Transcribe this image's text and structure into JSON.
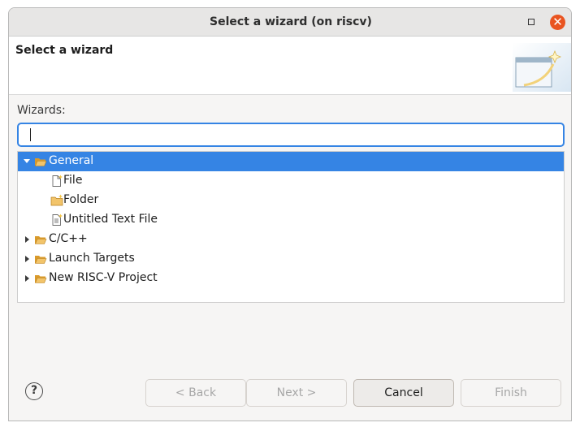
{
  "window": {
    "title": "Select a wizard  (on riscv)",
    "controls": {
      "maximize_icon": "maximize-icon",
      "close_icon": "close-icon",
      "close_glyph": "✕"
    }
  },
  "header": {
    "title": "Select a wizard",
    "graphic_icon": "wizard-banner-icon"
  },
  "filter": {
    "label": "Wizards:",
    "value": "",
    "placeholder": ""
  },
  "tree": {
    "items": [
      {
        "label": "General",
        "level": 0,
        "expanded": true,
        "selected": true,
        "icon": "folder-open-icon"
      },
      {
        "label": "File",
        "level": 1,
        "icon": "new-file-icon"
      },
      {
        "label": "Folder",
        "level": 1,
        "icon": "new-folder-icon"
      },
      {
        "label": "Untitled Text File",
        "level": 1,
        "icon": "new-text-file-icon"
      },
      {
        "label": "C/C++",
        "level": 0,
        "expanded": false,
        "icon": "folder-icon"
      },
      {
        "label": "Launch Targets",
        "level": 0,
        "expanded": false,
        "icon": "folder-icon"
      },
      {
        "label": "New RISC-V Project",
        "level": 0,
        "expanded": false,
        "icon": "folder-icon"
      }
    ]
  },
  "footer": {
    "help_glyph": "?",
    "back_label": "< Back",
    "next_label": "Next >",
    "cancel_label": "Cancel",
    "finish_label": "Finish"
  },
  "colors": {
    "accent": "#3584e4",
    "close": "#e95420",
    "folder": "#e8b04a"
  }
}
